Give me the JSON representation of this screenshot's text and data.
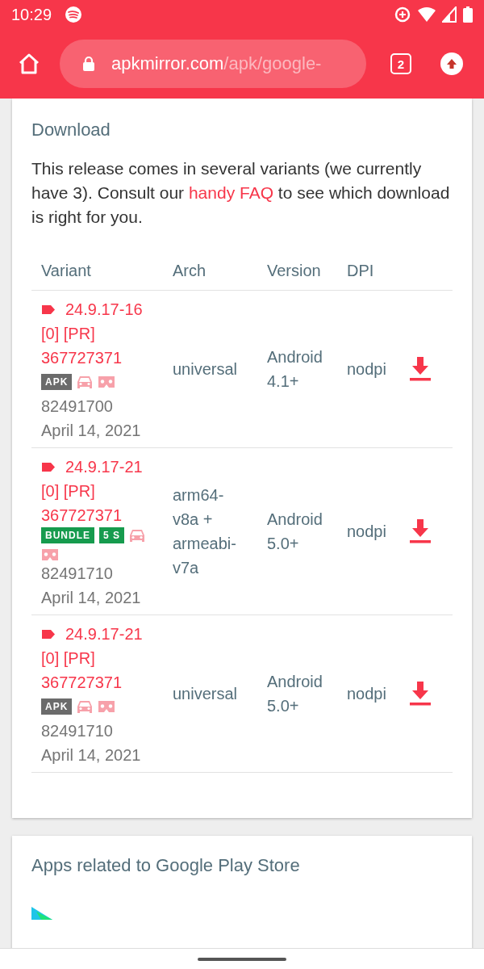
{
  "status_bar": {
    "time": "10:29"
  },
  "browser": {
    "url_host": "apkmirror.com",
    "url_path": "/apk/google-",
    "tab_count": "2"
  },
  "download": {
    "title": "Download",
    "intro_before": "This release comes in several variants (we currently have 3). Consult our ",
    "intro_link": "handy FAQ",
    "intro_after": " to see which download is right for you.",
    "columns": [
      "Variant",
      "Arch",
      "Version",
      "DPI"
    ],
    "rows": [
      {
        "variant": "24.9.17-16 [0] [PR] 367727371",
        "badges": [
          {
            "text": "APK",
            "color": "#6b6b6b"
          }
        ],
        "features": [
          {
            "kind": "car"
          },
          {
            "kind": "vr"
          }
        ],
        "code": "82491700",
        "date": "April 14, 2021",
        "arch": "universal",
        "version": "Android 4.1+",
        "dpi": "nodpi"
      },
      {
        "variant": "24.9.17-21 [0] [PR] 367727371",
        "badges": [
          {
            "text": "BUNDLE",
            "color": "#169b4e"
          },
          {
            "text": "5 S",
            "color": "#169b4e"
          }
        ],
        "features": [
          {
            "kind": "car"
          },
          {
            "kind": "vr"
          }
        ],
        "code": "82491710",
        "date": "April 14, 2021",
        "arch": "arm64-v8a + armeabi-v7a",
        "version": "Android 5.0+",
        "dpi": "nodpi"
      },
      {
        "variant": "24.9.17-21 [0] [PR] 367727371",
        "badges": [
          {
            "text": "APK",
            "color": "#6b6b6b"
          }
        ],
        "features": [
          {
            "kind": "car"
          },
          {
            "kind": "vr"
          }
        ],
        "code": "82491710",
        "date": "April 14, 2021",
        "arch": "universal",
        "version": "Android 5.0+",
        "dpi": "nodpi"
      }
    ]
  },
  "related": {
    "title": "Apps related to Google Play Store"
  }
}
